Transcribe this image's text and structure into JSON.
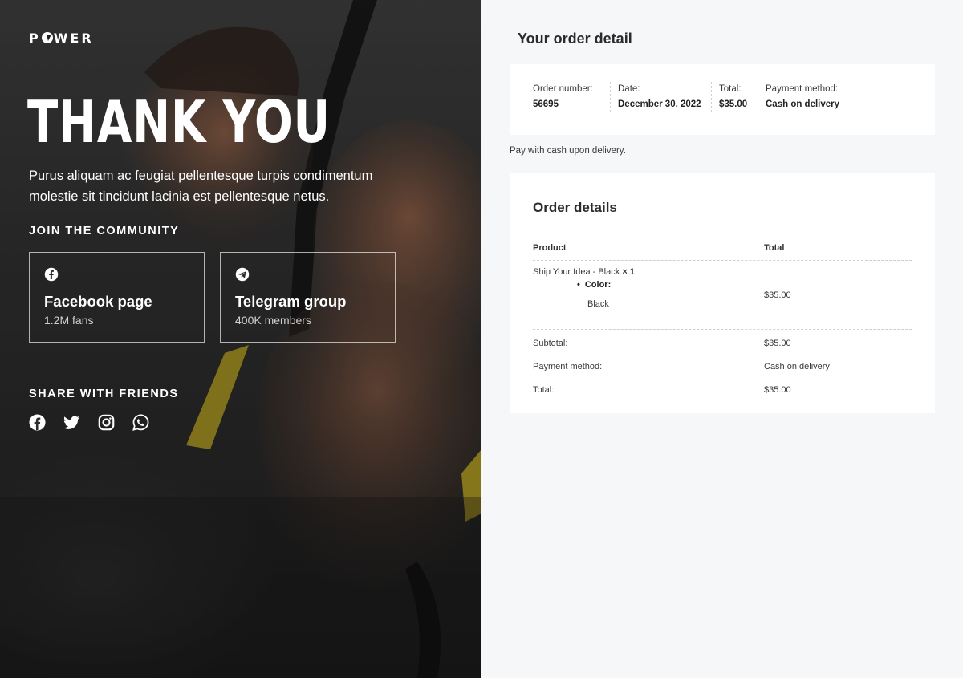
{
  "brand": {
    "logo_prefix": "P",
    "logo_suffix": "WER"
  },
  "hero": {
    "title": "THANK YOU",
    "lead": "Purus aliquam ac feugiat pellentesque turpis condimentum molestie sit tincidunt lacinia est pellentesque netus."
  },
  "community": {
    "label": "JOIN THE COMMUNITY",
    "cards": [
      {
        "icon": "facebook-icon",
        "title": "Facebook page",
        "subtitle": "1.2M fans"
      },
      {
        "icon": "telegram-icon",
        "title": "Telegram group",
        "subtitle": "400K members"
      }
    ]
  },
  "share": {
    "label": "SHARE WITH FRIENDS",
    "icons": [
      "facebook-icon",
      "twitter-icon",
      "instagram-icon",
      "whatsapp-icon"
    ]
  },
  "order": {
    "title": "Your order detail",
    "overview": [
      {
        "label": "Order number:",
        "value": "56695"
      },
      {
        "label": "Date:",
        "value": "December 30, 2022"
      },
      {
        "label": "Total:",
        "value": "$35.00"
      },
      {
        "label": "Payment method:",
        "value": "Cash on delivery"
      }
    ],
    "payment_note": "Pay with cash upon delivery."
  },
  "details": {
    "title": "Order details",
    "columns": [
      "Product",
      "Total"
    ],
    "item": {
      "name": "Ship Your Idea - Black",
      "qty": "× 1",
      "meta_key": "Color:",
      "meta_value": "Black",
      "total": "$35.00"
    },
    "rows": [
      {
        "label": "Subtotal:",
        "value": "$35.00"
      },
      {
        "label": "Payment method:",
        "value": "Cash on delivery"
      },
      {
        "label": "Total:",
        "value": "$35.00"
      }
    ]
  }
}
